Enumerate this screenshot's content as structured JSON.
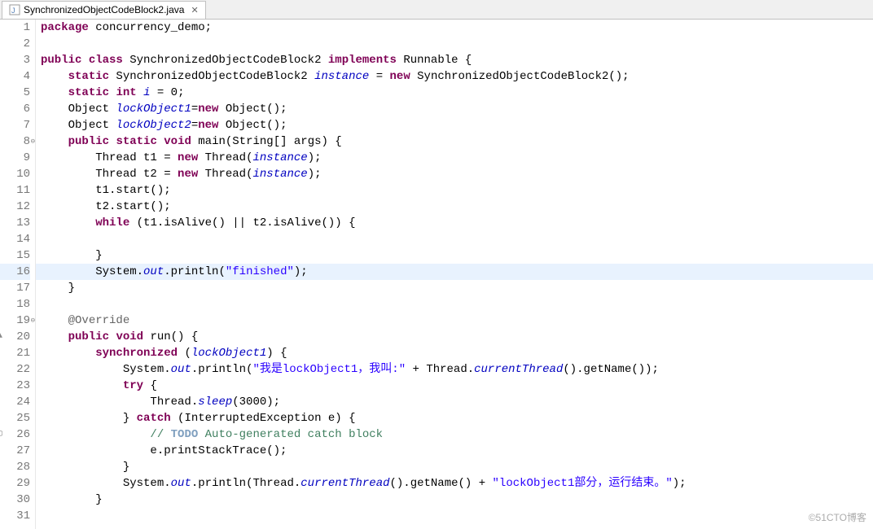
{
  "tab": {
    "filename": "SynchronizedObjectCodeBlock2.java",
    "close_glyph": "✕"
  },
  "watermark": "©51CTO博客",
  "colors": {
    "keyword": "#7f0055",
    "string": "#2a00ff",
    "field": "#0000c0",
    "annotation": "#646464",
    "comment": "#3f7f5f",
    "highlight": "#e8f2fe"
  },
  "code": {
    "package_kw": "package",
    "package_name": " concurrency_demo;",
    "public_kw": "public",
    "class_kw": "class",
    "static_kw": "static",
    "int_kw": "int",
    "void_kw": "void",
    "new_kw": "new",
    "while_kw": "while",
    "implements_kw": "implements",
    "synchronized_kw": "synchronized",
    "try_kw": "try",
    "catch_kw": "catch",
    "class_name": " SynchronizedObjectCodeBlock2 ",
    "runnable": "Runnable",
    "l3_tail": " {",
    "l4_a": " SynchronizedObjectCodeBlock2 ",
    "l4_instance": "instance",
    "l4_b": " = ",
    "l4_c": " SynchronizedObjectCodeBlock2();",
    "l5_a": " ",
    "l5_i": "i",
    "l5_b": " = 0;",
    "l6_a": "Object ",
    "l6_lock1": "lockObject1",
    "l6_b": "=",
    "l6_c": " Object();",
    "l7_lock2": "lockObject2",
    "l8_main": " main(String[] args) {",
    "l9_a": "Thread t1 = ",
    "l9_b": " Thread(",
    "l9_c": ");",
    "l10_a": "Thread t2 = ",
    "l11": "t1.start();",
    "l12": "t2.start();",
    "l13_a": " (t1.isAlive() || t2.isAlive()) {",
    "l15": "}",
    "l16_a": "System.",
    "l16_out": "out",
    "l16_b": ".println(",
    "l16_str": "\"finished\"",
    "l16_c": ");",
    "l17": "}",
    "l19_ann": "@Override",
    "l20_run": " run() {",
    "l21_a": " (",
    "l21_b": ") {",
    "l22_a": "System.",
    "l22_b": ".println(",
    "l22_str": "\"我是lockObject1，我叫:\"",
    "l22_c": " + Thread.",
    "l22_ct": "currentThread",
    "l22_d": "().getName());",
    "l23_a": " {",
    "l24_a": "Thread.",
    "l24_sleep": "sleep",
    "l24_b": "(3000);",
    "l25_a": "} ",
    "l25_b": " (InterruptedException e) {",
    "l26_a": "// ",
    "l26_todo": "TODO",
    "l26_b": " Auto-generated catch block",
    "l27": "e.printStackTrace();",
    "l28": "}",
    "l29_a": "System.",
    "l29_b": ".println(Thread.",
    "l29_c": "().getName() + ",
    "l29_str": "\"lockObject1部分，运行结束。\"",
    "l29_d": ");",
    "l30": "}"
  },
  "lines": [
    "1",
    "2",
    "3",
    "4",
    "5",
    "6",
    "7",
    "8",
    "9",
    "10",
    "11",
    "12",
    "13",
    "14",
    "15",
    "16",
    "17",
    "18",
    "19",
    "20",
    "21",
    "22",
    "23",
    "24",
    "25",
    "26",
    "27",
    "28",
    "29",
    "30",
    "31"
  ]
}
